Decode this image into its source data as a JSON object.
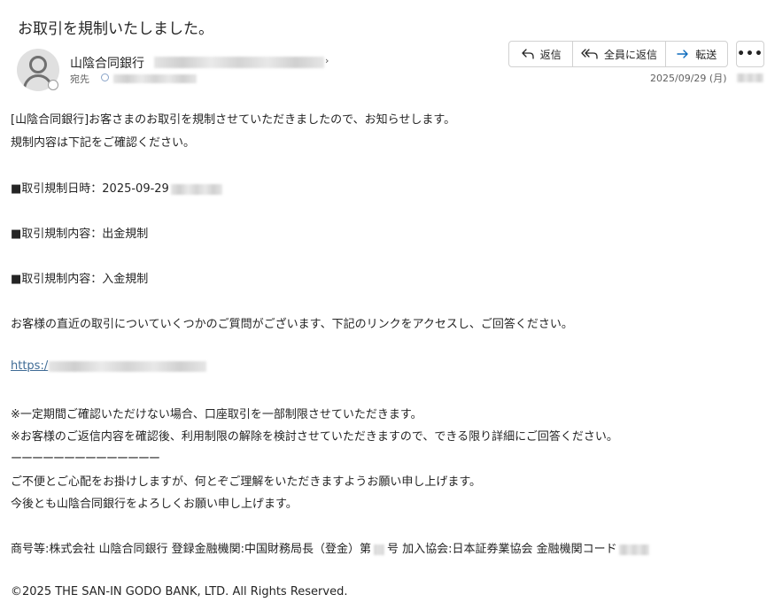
{
  "subject": "お取引を規制いたしました。",
  "sender": {
    "name": "山陰合同銀行",
    "to_label": "宛先",
    "date": "2025/09/29 (月)"
  },
  "actions": {
    "reply": "返信",
    "reply_all": "全員に返信",
    "forward": "転送",
    "more": "•••"
  },
  "icons": [
    "person-avatar-icon",
    "reply-icon",
    "reply-all-icon",
    "forward-icon",
    "more-icon",
    "chevron-right-icon"
  ],
  "colors": {
    "link": "#3f6b95",
    "forward_arrow": "#0f6cbd",
    "border": "#d1d1d1"
  },
  "body": {
    "intro1": "[山陰合同銀行]お客さまのお取引を規制させていただきましたので、お知らせします。",
    "intro2": "規制内容は下記をご確認ください。",
    "item_date": "■取引規制日時：2025-09-29",
    "item_content1": "■取引規制内容：出金規制",
    "item_content2": "■取引規制内容：入金規制",
    "question": "お客様の直近の取引についていくつかのご質問がございます、下記のリンクをアクセスし、ご回答ください。",
    "link_prefix": "https:/",
    "note1": "※一定期間ご確認いただけない場合、口座取引を一部制限させていただきます。",
    "note2": "※お客様のご返信内容を確認後、利用制限の解除を検討させていただきますので、できる限り詳細にご回答ください。",
    "divider": "ーーーーーーーーーーーーーー",
    "closing1": "ご不便とご心配をお掛けしますが、何とぞご理解をいただきますようお願い申し上げます。",
    "closing2": "今後とも山陰合同銀行をよろしくお願い申し上げます。",
    "company_a": "商号等:株式会社  山陰合同銀行  登録金融機関:中国財務局長（登金）第",
    "company_b": "号  加入協会:日本証券業協会  金融機関コード",
    "copyright": "©2025 THE SAN-IN GODO BANK, LTD. All Rights Reserved."
  }
}
